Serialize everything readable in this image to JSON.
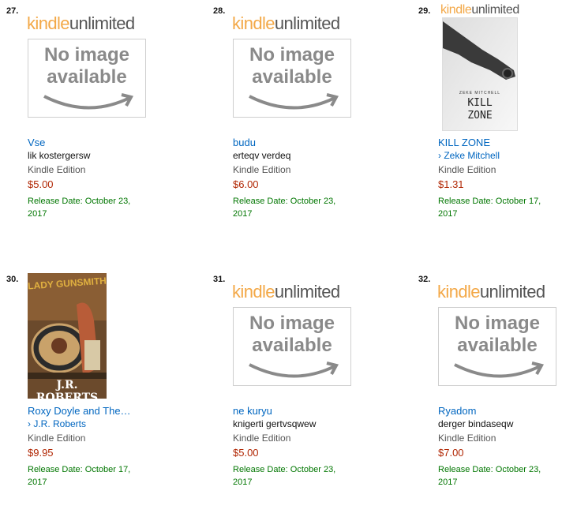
{
  "kindle_unlimited": {
    "kindle": "kindle",
    "unlimited": "unlimited"
  },
  "no_image": {
    "line1": "No image",
    "line2": "available"
  },
  "items": [
    {
      "rank": "27.",
      "title": "Vse",
      "author": "lik kostergersw",
      "edition": "Kindle Edition",
      "price": "$5.00",
      "release": "Release Date: October 23, 2017",
      "cover": "no-image"
    },
    {
      "rank": "28.",
      "title": "budu",
      "author": "erteqv verdeq",
      "edition": "Kindle Edition",
      "price": "$6.00",
      "release": "Release Date: October 23, 2017",
      "cover": "no-image"
    },
    {
      "rank": "29.",
      "title": "KILL ZONE",
      "author": "› Zeke Mitchell",
      "edition": "Kindle Edition",
      "price": "$1.31",
      "release": "Release Date: October 17, 2017",
      "cover": "kill-zone",
      "cover_text": {
        "author": "ZEKE MITCHELL",
        "line1": "KILL",
        "line2": "ZONE"
      }
    },
    {
      "rank": "30.",
      "title": "Roxy Doyle and The…",
      "author": "› J.R. Roberts",
      "edition": "Kindle Edition",
      "price": "$9.95",
      "release": "Release Date: October 17, 2017",
      "cover": "roxy",
      "cover_text": {
        "top": "LADY GUNSMITH",
        "author": "J.R. ROBERTS"
      }
    },
    {
      "rank": "31.",
      "title": "ne kuryu",
      "author": "knigerti gertvsqwew",
      "edition": "Kindle Edition",
      "price": "$5.00",
      "release": "Release Date: October 23, 2017",
      "cover": "no-image"
    },
    {
      "rank": "32.",
      "title": "Ryadom",
      "author": "derger bindaseqw",
      "edition": "Kindle Edition",
      "price": "$7.00",
      "release": "Release Date: October 23, 2017",
      "cover": "no-image"
    }
  ]
}
